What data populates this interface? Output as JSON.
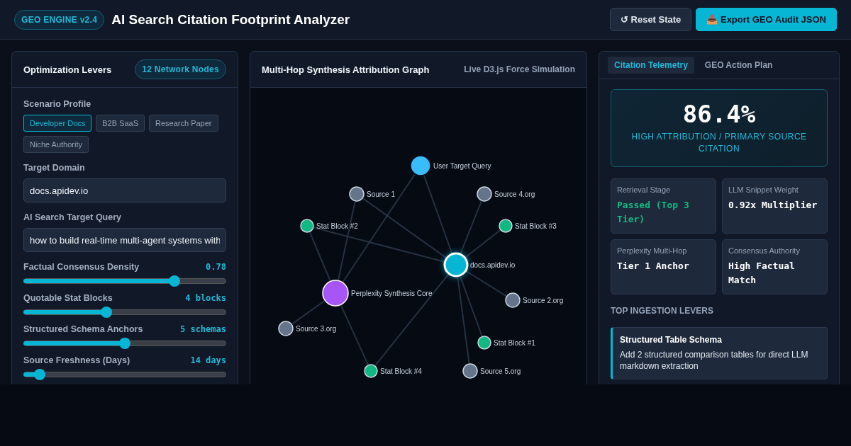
{
  "header": {
    "badge": "GEO ENGINE v2.4",
    "title": "AI Search Citation Footprint Analyzer",
    "buttons": [
      {
        "kind": "secondary",
        "label": "↺ Reset State"
      },
      {
        "kind": "primary",
        "label": "📥 Export GEO Audit JSON"
      }
    ]
  },
  "levers": {
    "title": "Optimization Levers",
    "node_count": "12 Network Nodes",
    "scenario_label": "Scenario Profile",
    "scenarios": [
      {
        "label": "Developer Docs",
        "selected": true
      },
      {
        "label": "B2B SaaS",
        "selected": false
      },
      {
        "label": "Research Paper",
        "selected": false
      },
      {
        "label": "Niche Authority",
        "selected": false
      }
    ],
    "fields": [
      {
        "label": "Target Domain",
        "value": "docs.apidev.io"
      },
      {
        "label": "AI Search Target Query",
        "value": "how to build real-time multi-agent systems with"
      }
    ],
    "sliders": [
      {
        "label": "Factual Consensus Density",
        "reading": "0.78",
        "level": 0.745
      },
      {
        "label": "Quotable Stat Blocks",
        "reading": "4 blocks",
        "level": 0.41
      },
      {
        "label": "Structured Schema Anchors",
        "reading": "5 schemas",
        "level": 0.5
      },
      {
        "label": "Source Freshness (Days)",
        "reading": "14 days",
        "level": 0.08
      }
    ]
  },
  "graph": {
    "title": "Multi-Hop Synthesis Attribution Graph",
    "subtitle": "Live D3.js Force Simulation",
    "nodes": [
      {
        "kind": "query",
        "label": "User Target Query"
      },
      {
        "kind": "source",
        "label": "Source 1"
      },
      {
        "kind": "source",
        "label": "Source 4.org"
      },
      {
        "kind": "stat",
        "label": "Stat Block #2"
      },
      {
        "kind": "stat",
        "label": "Stat Block #3"
      },
      {
        "kind": "target",
        "label": "docs.apidev.io"
      },
      {
        "kind": "engine",
        "label": "Perplexity Synthesis Core"
      },
      {
        "kind": "source",
        "label": "Source 2.org"
      },
      {
        "kind": "source",
        "label": "Source 3.org"
      },
      {
        "kind": "stat",
        "label": "Stat Block #1"
      },
      {
        "kind": "stat",
        "label": "Stat Block #4"
      },
      {
        "kind": "source",
        "label": "Source 5.org"
      }
    ]
  },
  "telemetry": {
    "tabs": [
      {
        "label": "Citation Telemetry",
        "selected": true
      },
      {
        "label": "GEO Action Plan",
        "selected": false
      }
    ],
    "score": "86.4%",
    "verdict": "HIGH ATTRIBUTION / PRIMARY SOURCE CITATION",
    "metrics": [
      {
        "label": "Retrieval Stage",
        "value": "Passed (Top 3 Tier)",
        "kind": "success"
      },
      {
        "label": "LLM Snippet Weight",
        "value": "0.92x Multiplier",
        "kind": "neutral"
      },
      {
        "label": "Perplexity Multi-Hop",
        "value": "Tier 1 Anchor",
        "kind": "neutral"
      },
      {
        "label": "Consensus Authority",
        "value": "High Factual Match",
        "kind": "neutral"
      }
    ],
    "levers_title": "TOP INGESTION LEVERS",
    "levers": [
      {
        "title": "Structured Table Schema",
        "text": "Add 2 structured comparison tables for direct LLM markdown extraction"
      }
    ]
  }
}
